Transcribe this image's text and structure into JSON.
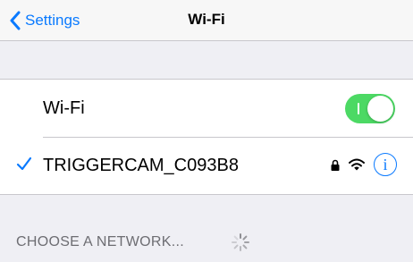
{
  "navbar": {
    "back_label": "Settings",
    "title": "Wi-Fi"
  },
  "wifi_toggle": {
    "label": "Wi-Fi",
    "state": "on",
    "color": "#4cd964"
  },
  "connected_network": {
    "name": "TRIGGERCAM_C093B8",
    "secured": true,
    "info_glyph": "i",
    "icons": [
      "checkmark-icon",
      "lock-icon",
      "wifi-signal-icon",
      "info-icon"
    ]
  },
  "networks_section": {
    "header": "CHOOSE A NETWORK...",
    "loading": true
  },
  "colors": {
    "accent": "#0a7aff",
    "background": "#efeff4",
    "header_text": "#6d6d72"
  }
}
